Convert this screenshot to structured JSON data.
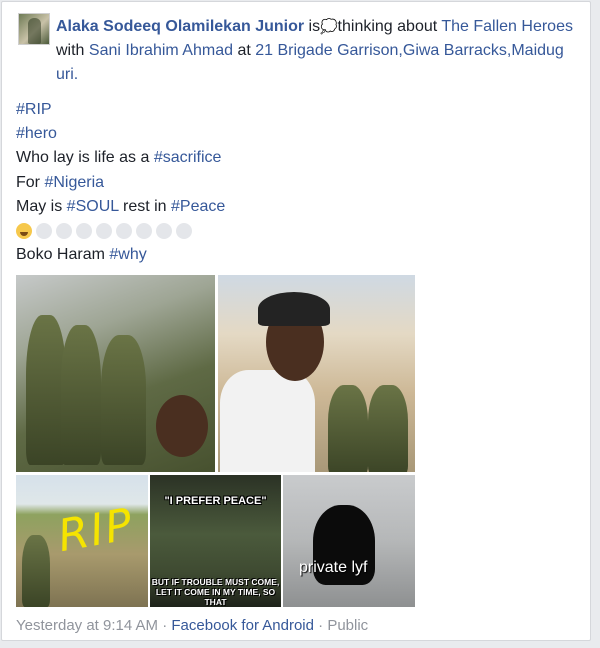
{
  "post": {
    "author": "Alaka Sodeeq Olamilekan Junior",
    "is_text": "is",
    "activity_icon": "thought-bubble-icon",
    "activity_text": "thinking about",
    "activity_target": "The Fallen Heroes",
    "with_text": "with",
    "tagged_person": "Sani Ibrahim Ahmad",
    "at_text": "at",
    "location_line1": "21 Brigade Garrison,Giwa Barracks,Maidug",
    "location_line2": "uri.",
    "lines": [
      {
        "hashtag": "#RIP"
      },
      {
        "hashtag": "#hero"
      },
      {
        "text": "Who lay  is life as a ",
        "hashtag": "#sacrifice"
      },
      {
        "text": "For ",
        "hashtag": "#Nigeria"
      },
      {
        "text": "May is ",
        "hashtag": "#SOUL",
        "text2": " rest in ",
        "hashtag2": "#Peace"
      }
    ],
    "emoji_row": [
      "crying-face-icon",
      "blank-emoji",
      "blank-emoji",
      "blank-emoji",
      "blank-emoji",
      "blank-emoji",
      "blank-emoji",
      "blank-emoji",
      "blank-emoji"
    ],
    "last_line": {
      "text": "Boko Haram ",
      "hashtag": "#why"
    },
    "photos": {
      "rip_caption": "RIP",
      "meme_top": "\"I PREFER PEACE\"",
      "meme_bottom_1": "BUT IF TROUBLE MUST COME,",
      "meme_bottom_2": "LET IT COME IN MY TIME, SO THAT",
      "private_caption": "private lyf"
    },
    "footer": {
      "time": "Yesterday at 9:14  AM",
      "sep1": " · ",
      "app": "Facebook for Android",
      "sep2": " · ",
      "privacy": "Public"
    }
  },
  "colors": {
    "link": "#365899",
    "text": "#1d2129",
    "meta": "#90949c"
  }
}
